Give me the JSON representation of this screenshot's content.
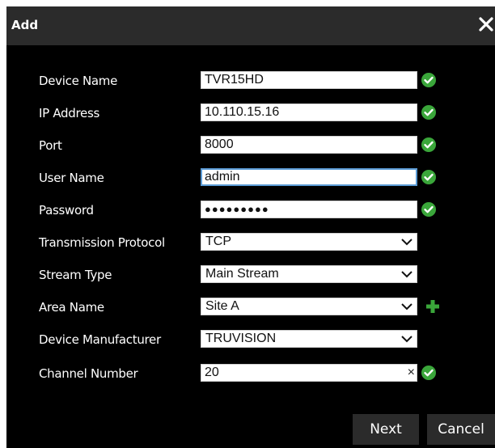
{
  "dialog": {
    "title": "Add"
  },
  "form": {
    "device_name": {
      "label": "Device Name",
      "value": "TVR15HD"
    },
    "ip_address": {
      "label": "IP Address",
      "value": "10.110.15.16"
    },
    "port": {
      "label": "Port",
      "value": "8000"
    },
    "user_name": {
      "label": "User Name",
      "value": "admin"
    },
    "password": {
      "label": "Password",
      "value": "●●●●●●●●●"
    },
    "transmission_protocol": {
      "label": "Transmission Protocol",
      "value": "TCP"
    },
    "stream_type": {
      "label": "Stream Type",
      "value": "Main Stream"
    },
    "area_name": {
      "label": "Area Name",
      "value": "Site A"
    },
    "device_manufacturer": {
      "label": "Device Manufacturer",
      "value": "TRUVISION"
    },
    "channel_number": {
      "label": "Channel Number",
      "value": "20",
      "clear": "×"
    }
  },
  "buttons": {
    "next": "Next",
    "cancel": "Cancel"
  },
  "colors": {
    "valid": "#3aa63a",
    "background": "#000000",
    "titlebar": "#2b2b2b"
  }
}
